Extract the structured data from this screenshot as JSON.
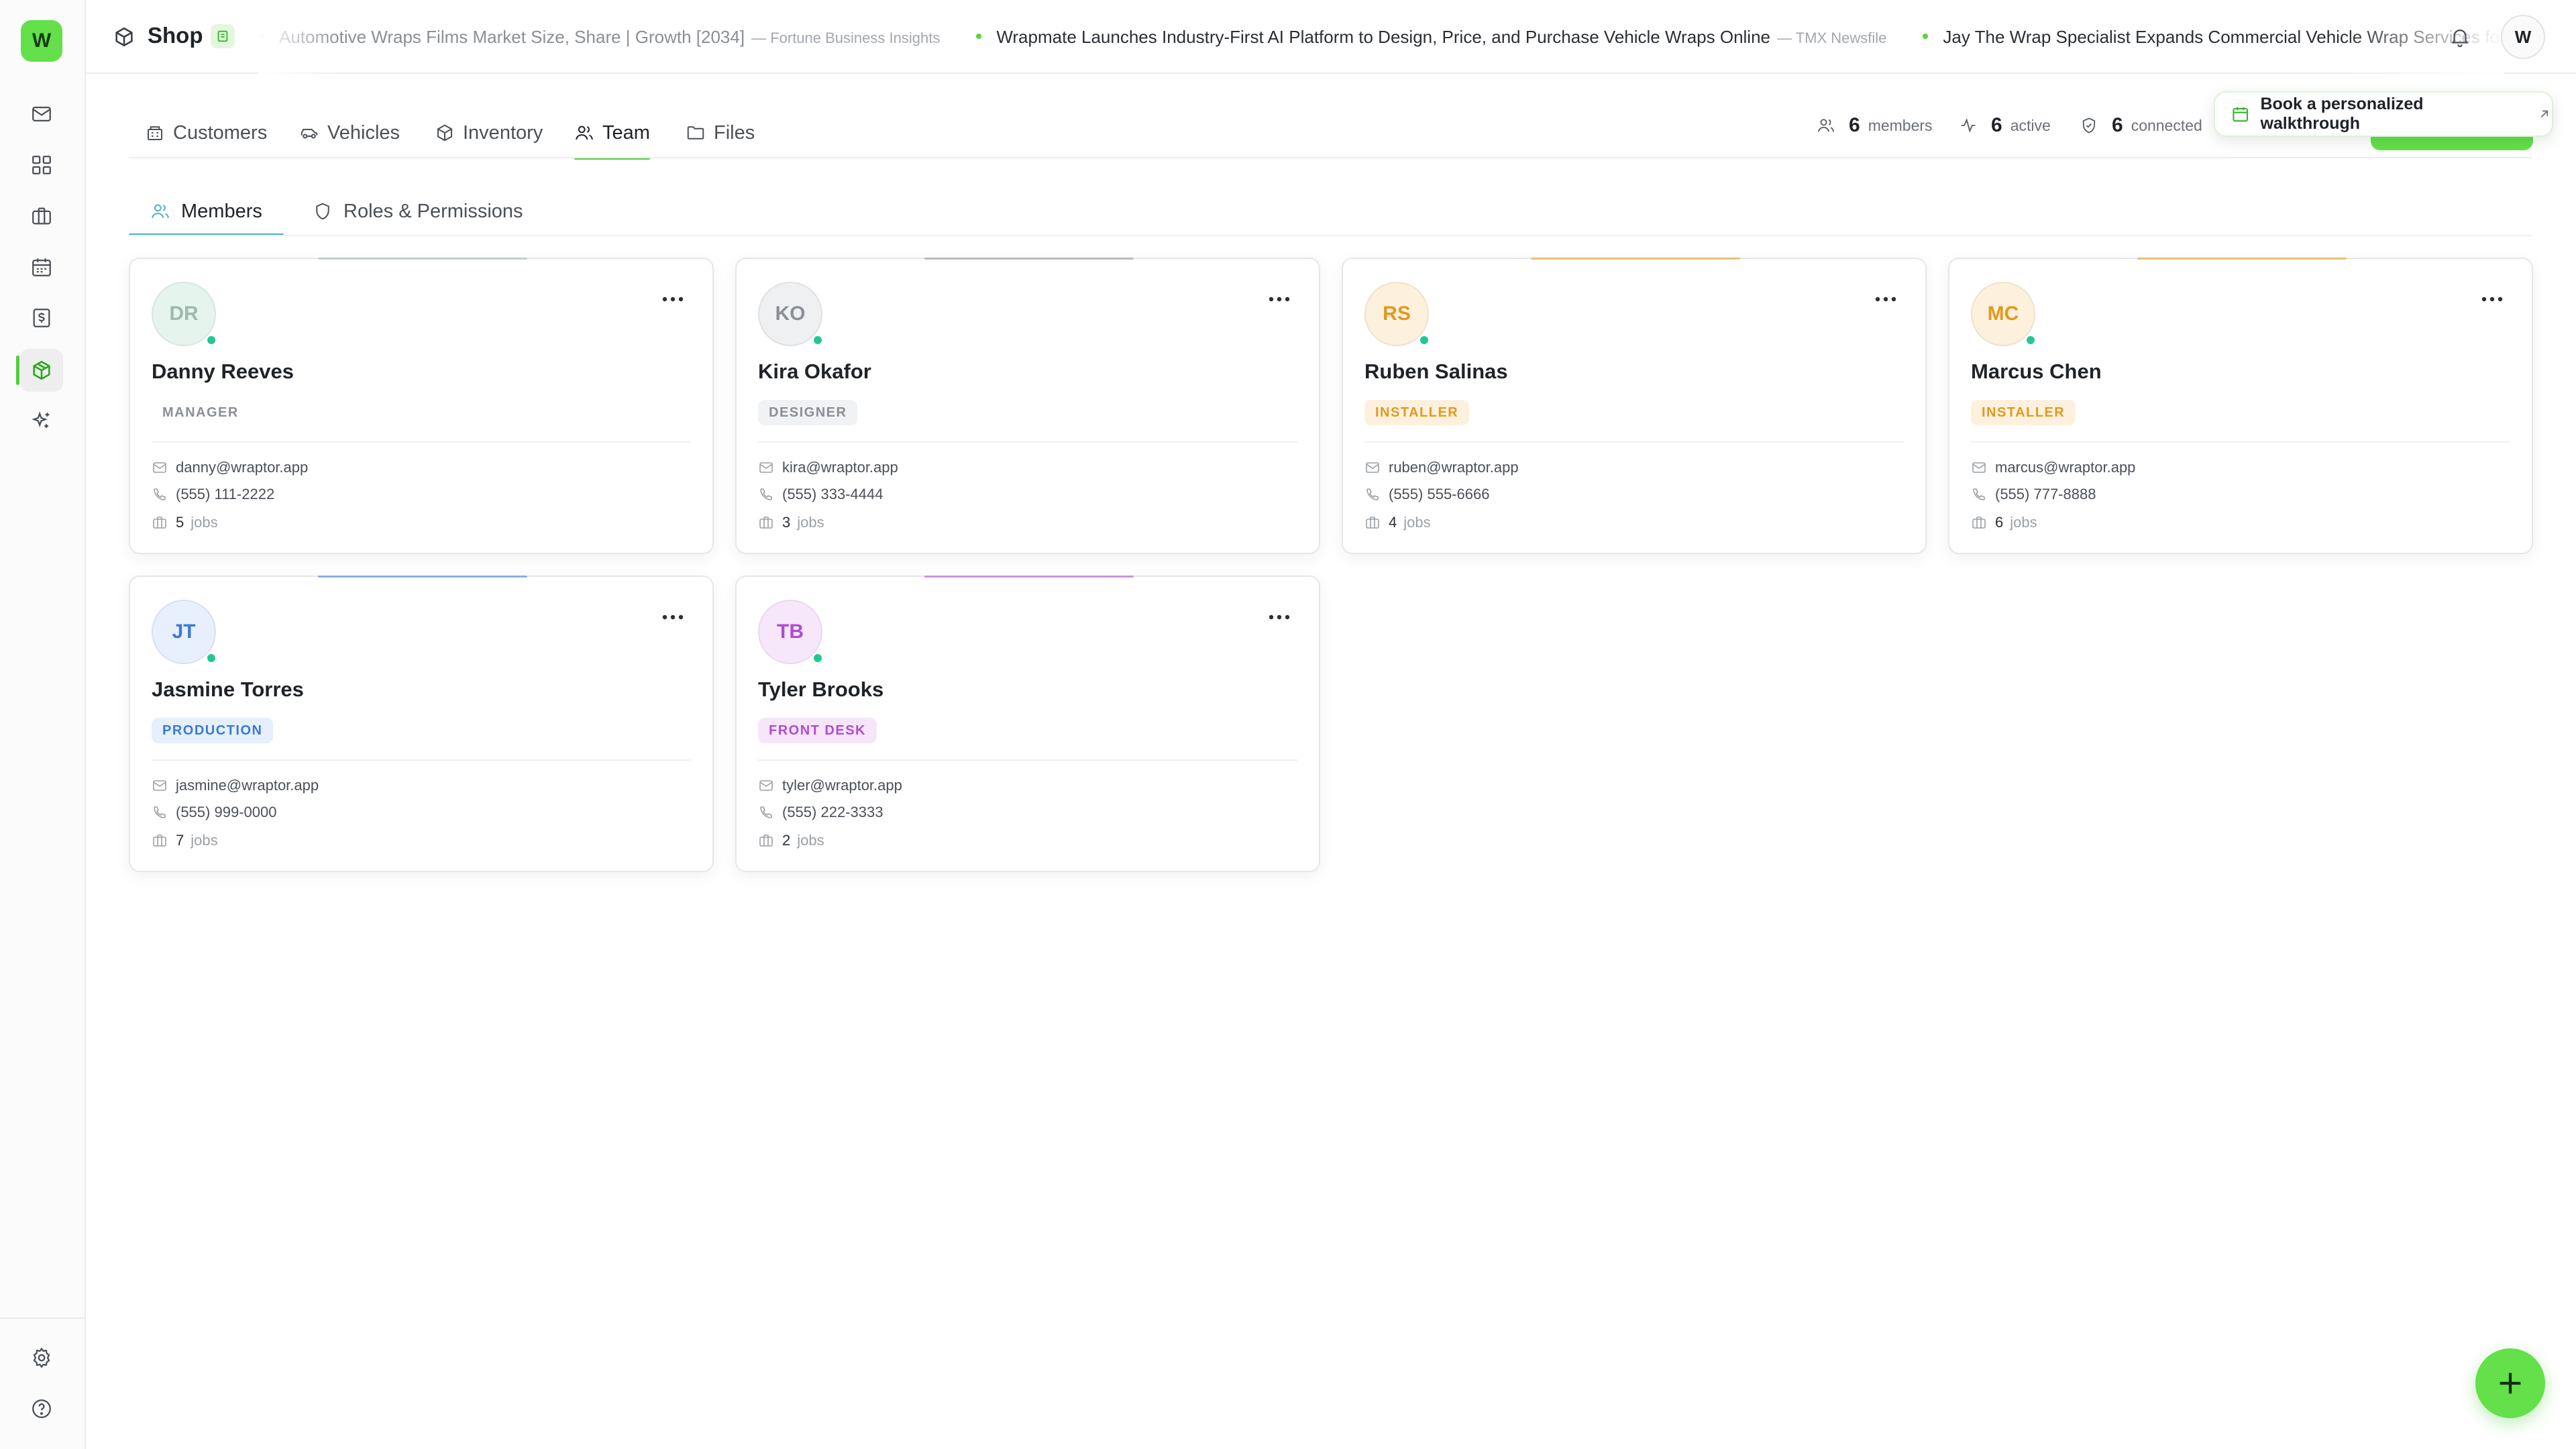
{
  "app": {
    "logo_letter": "W",
    "title": "Shop",
    "user_initial": "W"
  },
  "ticker": [
    {
      "headline": "Automotive Wraps Films Market Size, Share | Growth [2034]",
      "source": "— Fortune Business Insights",
      "dim": true
    },
    {
      "headline": "Wrapmate Launches Industry-First AI Platform to Design, Price, and Purchase Vehicle Wraps Online",
      "source": "— TMX Newsfile",
      "dim": false
    },
    {
      "headline": "Jay The Wrap Specialist Expands Commercial Vehicle Wrap Services for Mobile Businesses",
      "source": "",
      "dim": false
    }
  ],
  "nav": {
    "rail_icons": [
      "mail-icon",
      "dashboard-icon",
      "briefcase-icon",
      "calendar-icon",
      "invoice-icon",
      "package-icon",
      "sparkles-icon"
    ],
    "rail_bottom_icons": [
      "settings-icon",
      "help-icon"
    ],
    "active_rail": "package-icon"
  },
  "tabs": [
    {
      "label": "Customers",
      "icon": "building-icon"
    },
    {
      "label": "Vehicles",
      "icon": "car-icon"
    },
    {
      "label": "Inventory",
      "icon": "box-icon"
    },
    {
      "label": "Team",
      "icon": "users-icon",
      "active": true
    },
    {
      "label": "Files",
      "icon": "folder-icon"
    }
  ],
  "stats": {
    "members": {
      "value": "6",
      "label": "members"
    },
    "active": {
      "value": "6",
      "label": "active"
    },
    "connected": {
      "value": "6",
      "label": "connected"
    }
  },
  "walkthrough": {
    "label": "Book a personalized walkthrough"
  },
  "subtabs": [
    {
      "label": "Members",
      "active": true
    },
    {
      "label": "Roles & Permissions",
      "active": false
    }
  ],
  "jobs_label": "jobs",
  "members": [
    {
      "initials": "DR",
      "name": "Danny Reeves",
      "role": "MANAGER",
      "email": "danny@wraptor.app",
      "phone": "(555) 111-2222",
      "jobs": "5"
    },
    {
      "initials": "KO",
      "name": "Kira Okafor",
      "role": "DESIGNER",
      "email": "kira@wraptor.app",
      "phone": "(555) 333-4444",
      "jobs": "3"
    },
    {
      "initials": "RS",
      "name": "Ruben Salinas",
      "role": "INSTALLER",
      "email": "ruben@wraptor.app",
      "phone": "(555) 555-6666",
      "jobs": "4"
    },
    {
      "initials": "MC",
      "name": "Marcus Chen",
      "role": "INSTALLER",
      "email": "marcus@wraptor.app",
      "phone": "(555) 777-8888",
      "jobs": "6"
    },
    {
      "initials": "JT",
      "name": "Jasmine Torres",
      "role": "PRODUCTION",
      "email": "jasmine@wraptor.app",
      "phone": "(555) 999-0000",
      "jobs": "7"
    },
    {
      "initials": "TB",
      "name": "Tyler Brooks",
      "role": "FRONT DESK",
      "email": "tyler@wraptor.app",
      "phone": "(555) 222-3333",
      "jobs": "2"
    }
  ],
  "colors": {
    "brand_green": "#63e04a",
    "online_dot": "#22c98f",
    "role_manager_bg": "#ffffff",
    "role_manager_fg": "#8b8f95",
    "role_designer_bg": "#f1f2f3",
    "role_designer_fg": "#8b8f95",
    "role_installer_bg": "#fdf1de",
    "role_installer_fg": "#e29a1c",
    "role_production_bg": "#e6effc",
    "role_production_fg": "#3a7bd5",
    "role_frontdesk_bg": "#f6e6fa",
    "role_frontdesk_fg": "#b04ccf"
  }
}
